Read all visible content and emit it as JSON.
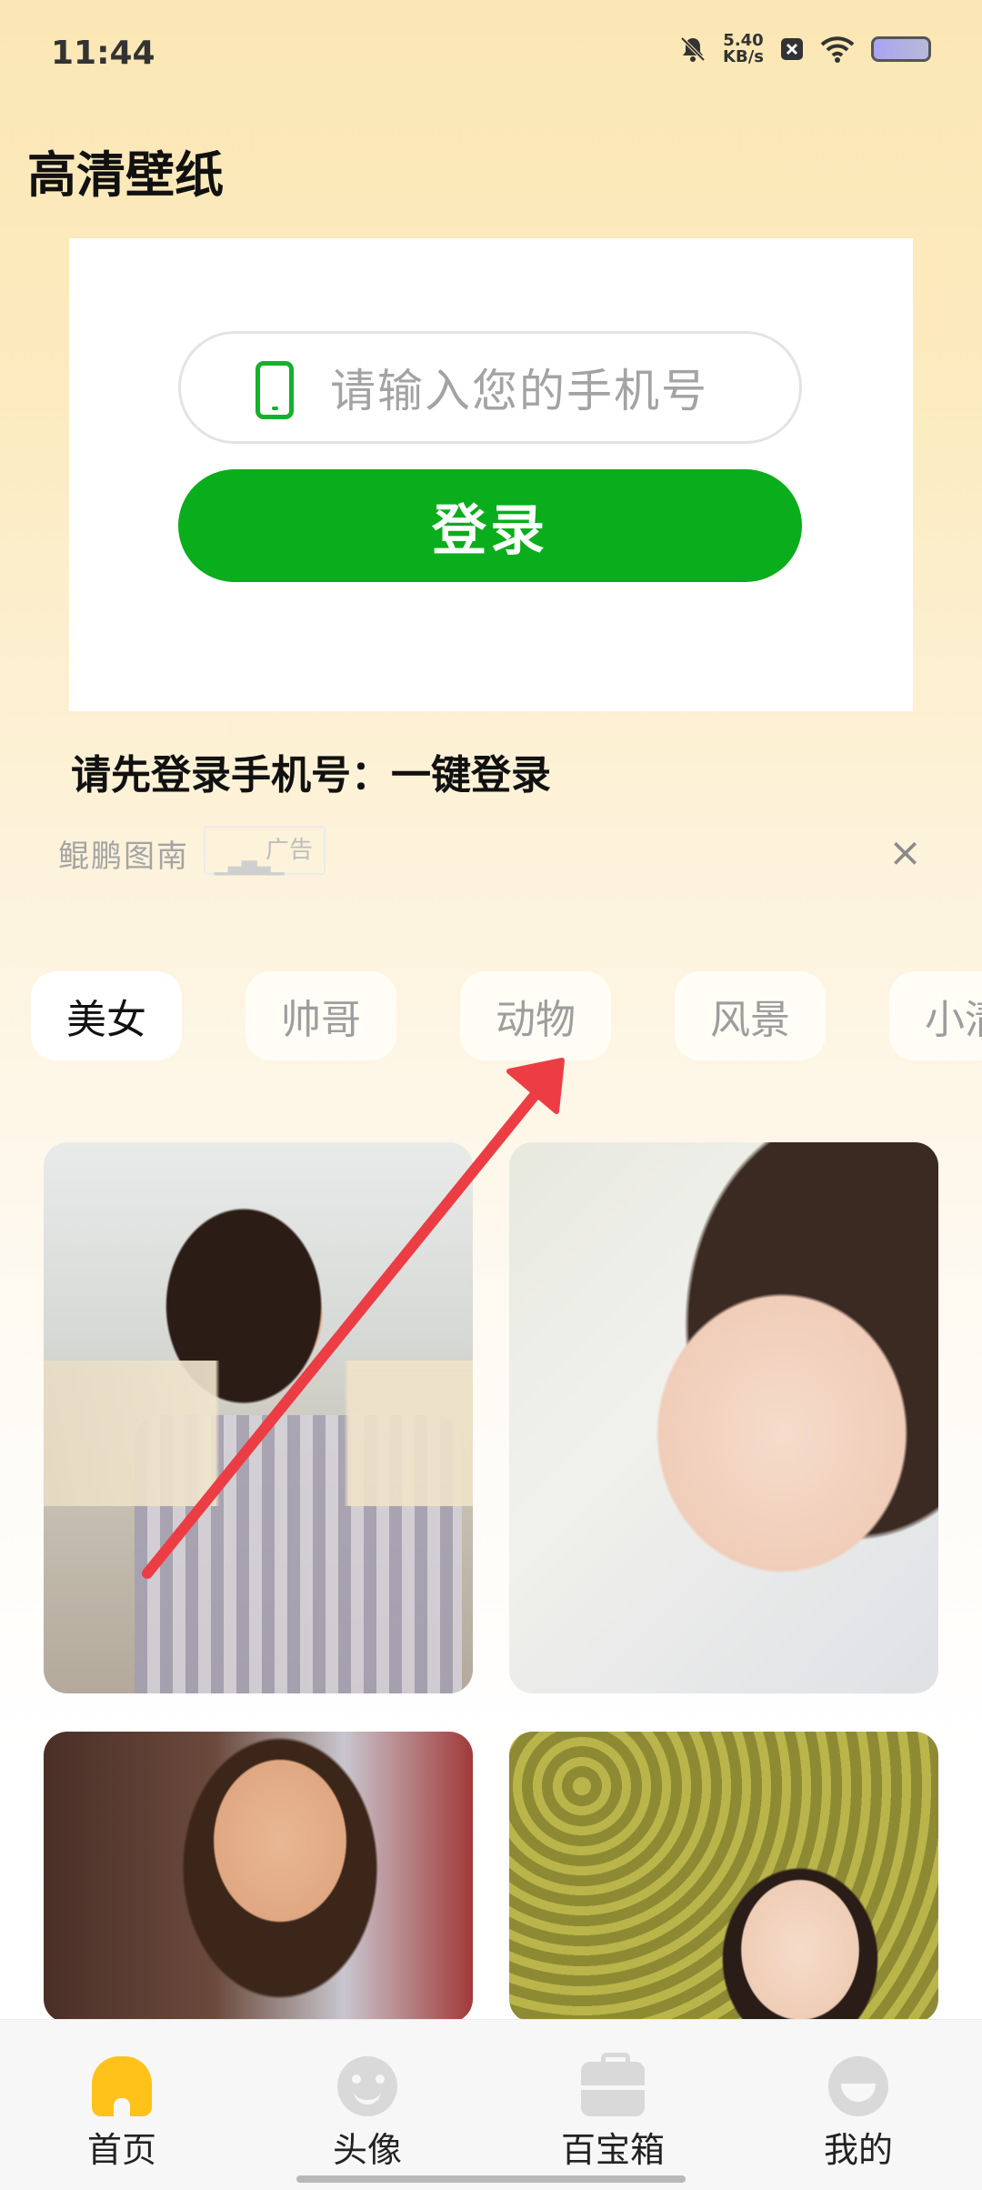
{
  "status_bar": {
    "time": "11:44",
    "network_speed_value": "5.40",
    "network_speed_unit": "KB/s",
    "icons": [
      "bell-muted-icon",
      "close-box-icon",
      "wifi-icon",
      "battery-icon"
    ]
  },
  "header": {
    "title": "高清壁纸"
  },
  "login": {
    "phone_placeholder": "请输入您的手机号",
    "button_label": "登录",
    "hint": "请先登录手机号：一键登录"
  },
  "ad": {
    "brand": "鲲鹏图南",
    "tag": "广告"
  },
  "categories": [
    "美女",
    "帅哥",
    "动物",
    "风景",
    "小清"
  ],
  "active_category": "美女",
  "bottom_nav": {
    "items": [
      {
        "label": "首页",
        "icon": "home-icon",
        "active": true
      },
      {
        "label": "头像",
        "icon": "avatar-icon",
        "active": false
      },
      {
        "label": "百宝箱",
        "icon": "toolbox-icon",
        "active": false
      },
      {
        "label": "我的",
        "icon": "profile-icon",
        "active": false
      }
    ]
  },
  "colors": {
    "accent_green": "#0aad1c",
    "home_icon_yellow": "#ffc21a",
    "annotation_arrow": "#ec3d45"
  }
}
